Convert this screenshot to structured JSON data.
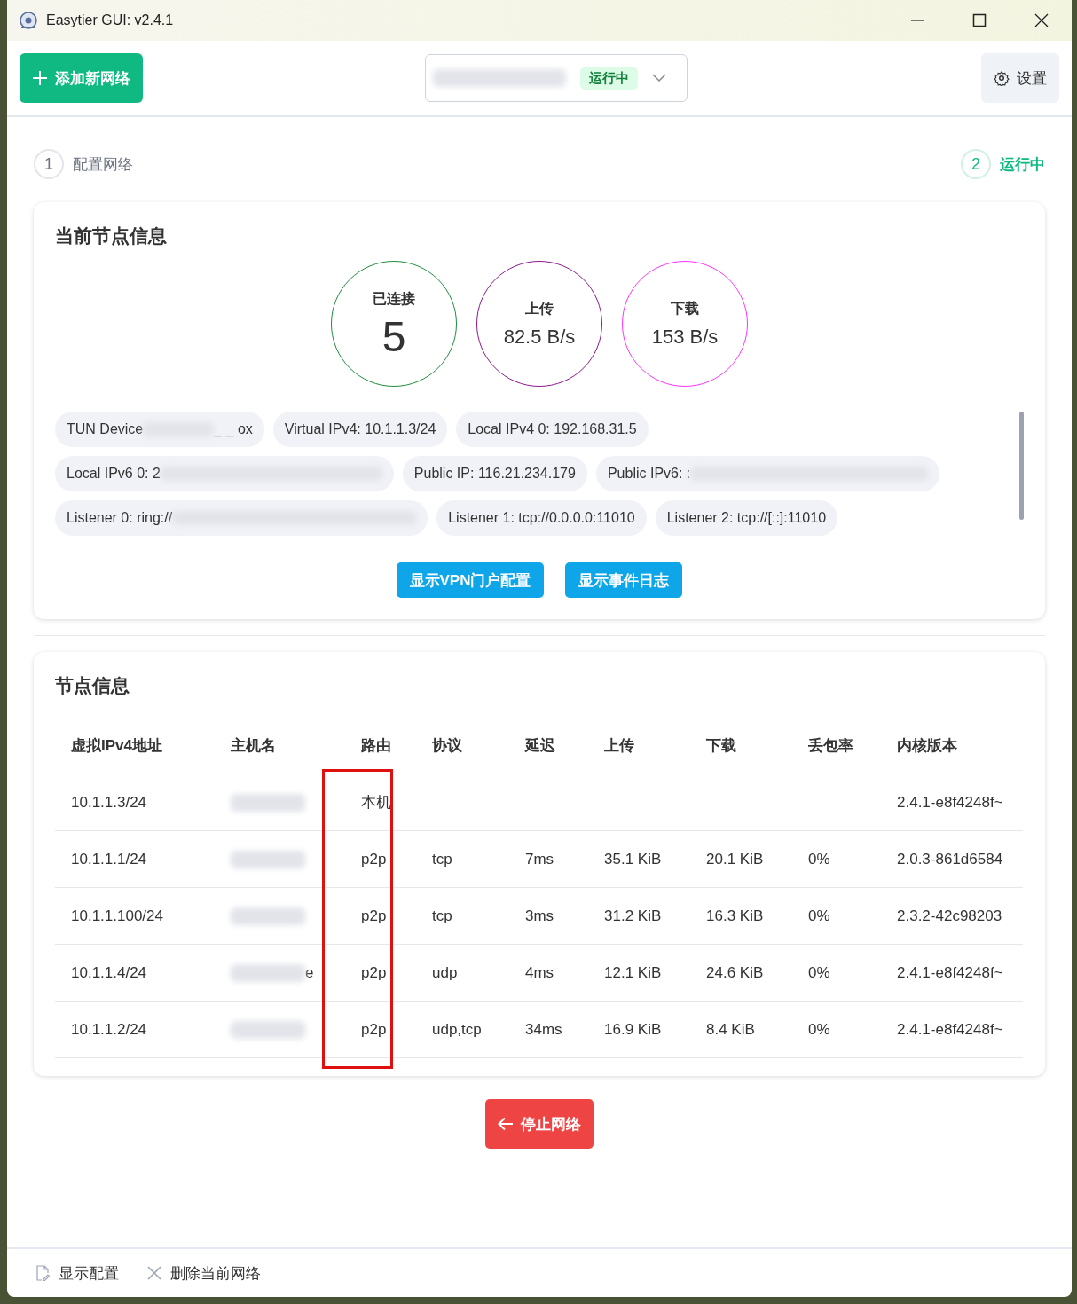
{
  "window": {
    "title": "Easytier GUI: v2.4.1"
  },
  "toolbar": {
    "add_button": "添加新网络",
    "network_select": {
      "status": "运行中"
    },
    "settings_button": "设置"
  },
  "steps": [
    {
      "number": "1",
      "label": "配置网络",
      "selected": false
    },
    {
      "number": "2",
      "label": "运行中",
      "selected": true
    }
  ],
  "node_info": {
    "title": "当前节点信息",
    "stats": [
      {
        "label": "已连接",
        "value": "5",
        "big": true,
        "color": "#1e8e3e"
      },
      {
        "label": "上传",
        "value": "82.5 B/s",
        "big": false,
        "color": "#8b1a8b"
      },
      {
        "label": "下载",
        "value": "153 B/s",
        "big": false,
        "color": "#ff33ff"
      }
    ],
    "chips": [
      {
        "label": "TUN Device ",
        "redacted": true,
        "tail": "_ _ ox"
      },
      {
        "label": "Virtual IPv4: 10.1.1.3/24",
        "redacted": false
      },
      {
        "label": "Local IPv4 0: 192.168.31.5",
        "redacted": false
      },
      {
        "label": "Local IPv6 0: 2",
        "redacted": true
      },
      {
        "label": "Public IP: 116.21.234.179",
        "redacted": false
      },
      {
        "label": "Public IPv6: :",
        "redacted": true
      },
      {
        "label": "Listener 0: ring://",
        "redacted": true
      },
      {
        "label": "Listener 1: tcp://0.0.0.0:11010",
        "redacted": false
      },
      {
        "label": "Listener 2: tcp://[::]:11010",
        "redacted": false
      }
    ],
    "buttons": [
      "显示VPN门户配置",
      "显示事件日志"
    ]
  },
  "peers": {
    "title": "节点信息",
    "columns": [
      {
        "label": "虚拟IPv4地址",
        "highlighted": false
      },
      {
        "label": "主机名",
        "highlighted": false
      },
      {
        "label": "路由",
        "highlighted": true
      },
      {
        "label": "协议",
        "highlighted": false
      },
      {
        "label": "延迟",
        "highlighted": false
      },
      {
        "label": "上传",
        "highlighted": false
      },
      {
        "label": "下载",
        "highlighted": false
      },
      {
        "label": "丢包率",
        "highlighted": false
      },
      {
        "label": "内核版本",
        "highlighted": false
      }
    ],
    "rows": [
      {
        "ip": "10.1.1.3/24",
        "route": "本机",
        "version": "2.4.1-e8f4248f~"
      },
      {
        "ip": "10.1.1.1/24",
        "route": "p2p",
        "protocol": "tcp",
        "latency": "7ms",
        "up": "35.1 KiB",
        "down": "20.1 KiB",
        "loss": "0%",
        "version": "2.0.3-861d6584"
      },
      {
        "ip": "10.1.1.100/24",
        "route": "p2p",
        "protocol": "tcp",
        "latency": "3ms",
        "up": "31.2 KiB",
        "down": "16.3 KiB",
        "loss": "0%",
        "version": "2.3.2-42c98203"
      },
      {
        "ip": "10.1.1.4/24",
        "hostname_tail": "e",
        "route": "p2p",
        "protocol": "udp",
        "latency": "4ms",
        "up": "12.1 KiB",
        "down": "24.6 KiB",
        "loss": "0%",
        "version": "2.4.1-e8f4248f~"
      },
      {
        "ip": "10.1.1.2/24",
        "route": "p2p",
        "protocol": "udp,tcp",
        "latency": "34ms",
        "up": "16.9 KiB",
        "down": "8.4 KiB",
        "loss": "0%",
        "version": "2.4.1-e8f4248f~"
      }
    ]
  },
  "stop_button": "停止网络",
  "footer": [
    "显示配置",
    "删除当前网络"
  ]
}
